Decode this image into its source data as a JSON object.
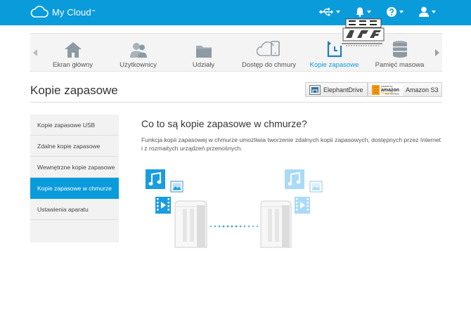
{
  "app": {
    "title": "My Cloud",
    "trademark": "™"
  },
  "topbar": {
    "icons": [
      {
        "name": "usb-icon"
      },
      {
        "name": "bell-icon"
      },
      {
        "name": "help-icon"
      },
      {
        "name": "user-icon"
      }
    ]
  },
  "nav": {
    "items": [
      {
        "label": "Ekran główny",
        "icon": "home-icon"
      },
      {
        "label": "Użytkownicy",
        "icon": "users-icon"
      },
      {
        "label": "Udziały",
        "icon": "folder-icon"
      },
      {
        "label": "Dostęp do chmury",
        "icon": "cloud-device-icon"
      },
      {
        "label": "Kopie zapasowe",
        "icon": "backup-icon",
        "active": true
      },
      {
        "label": "Pamięć masowa",
        "icon": "storage-icon"
      }
    ]
  },
  "page": {
    "title": "Kopie zapasowe"
  },
  "providers": {
    "elephant": "ElephantDrive",
    "amazon_logo_top": "powered by",
    "amazon_logo_main": "amazon",
    "amazon_logo_sub": "web services",
    "amazon": "Amazon S3"
  },
  "sidebar": {
    "items": [
      {
        "label": "Kopie zapasowe USB"
      },
      {
        "label": "Zdalne kopie zapasowe"
      },
      {
        "label": "Wewnętrzne kopie zapasowe"
      },
      {
        "label": "Kopie zapasowe w chmurze",
        "active": true
      },
      {
        "label": "Ustawienia aparatu"
      }
    ]
  },
  "content": {
    "heading": "Co to są kopie zapasowe w chmurze?",
    "description": "Funkcja kopii zapasowej w chmurze umożliwia tworzenie zdalnych kopii zapasowych, dostępnych przez Internet i z rozmaitych urządzeń przenośnych."
  },
  "colors": {
    "accent": "#0a9bdb",
    "sidebar_bg": "#f2f2f2",
    "nav_bg": "#f4f4f4"
  }
}
